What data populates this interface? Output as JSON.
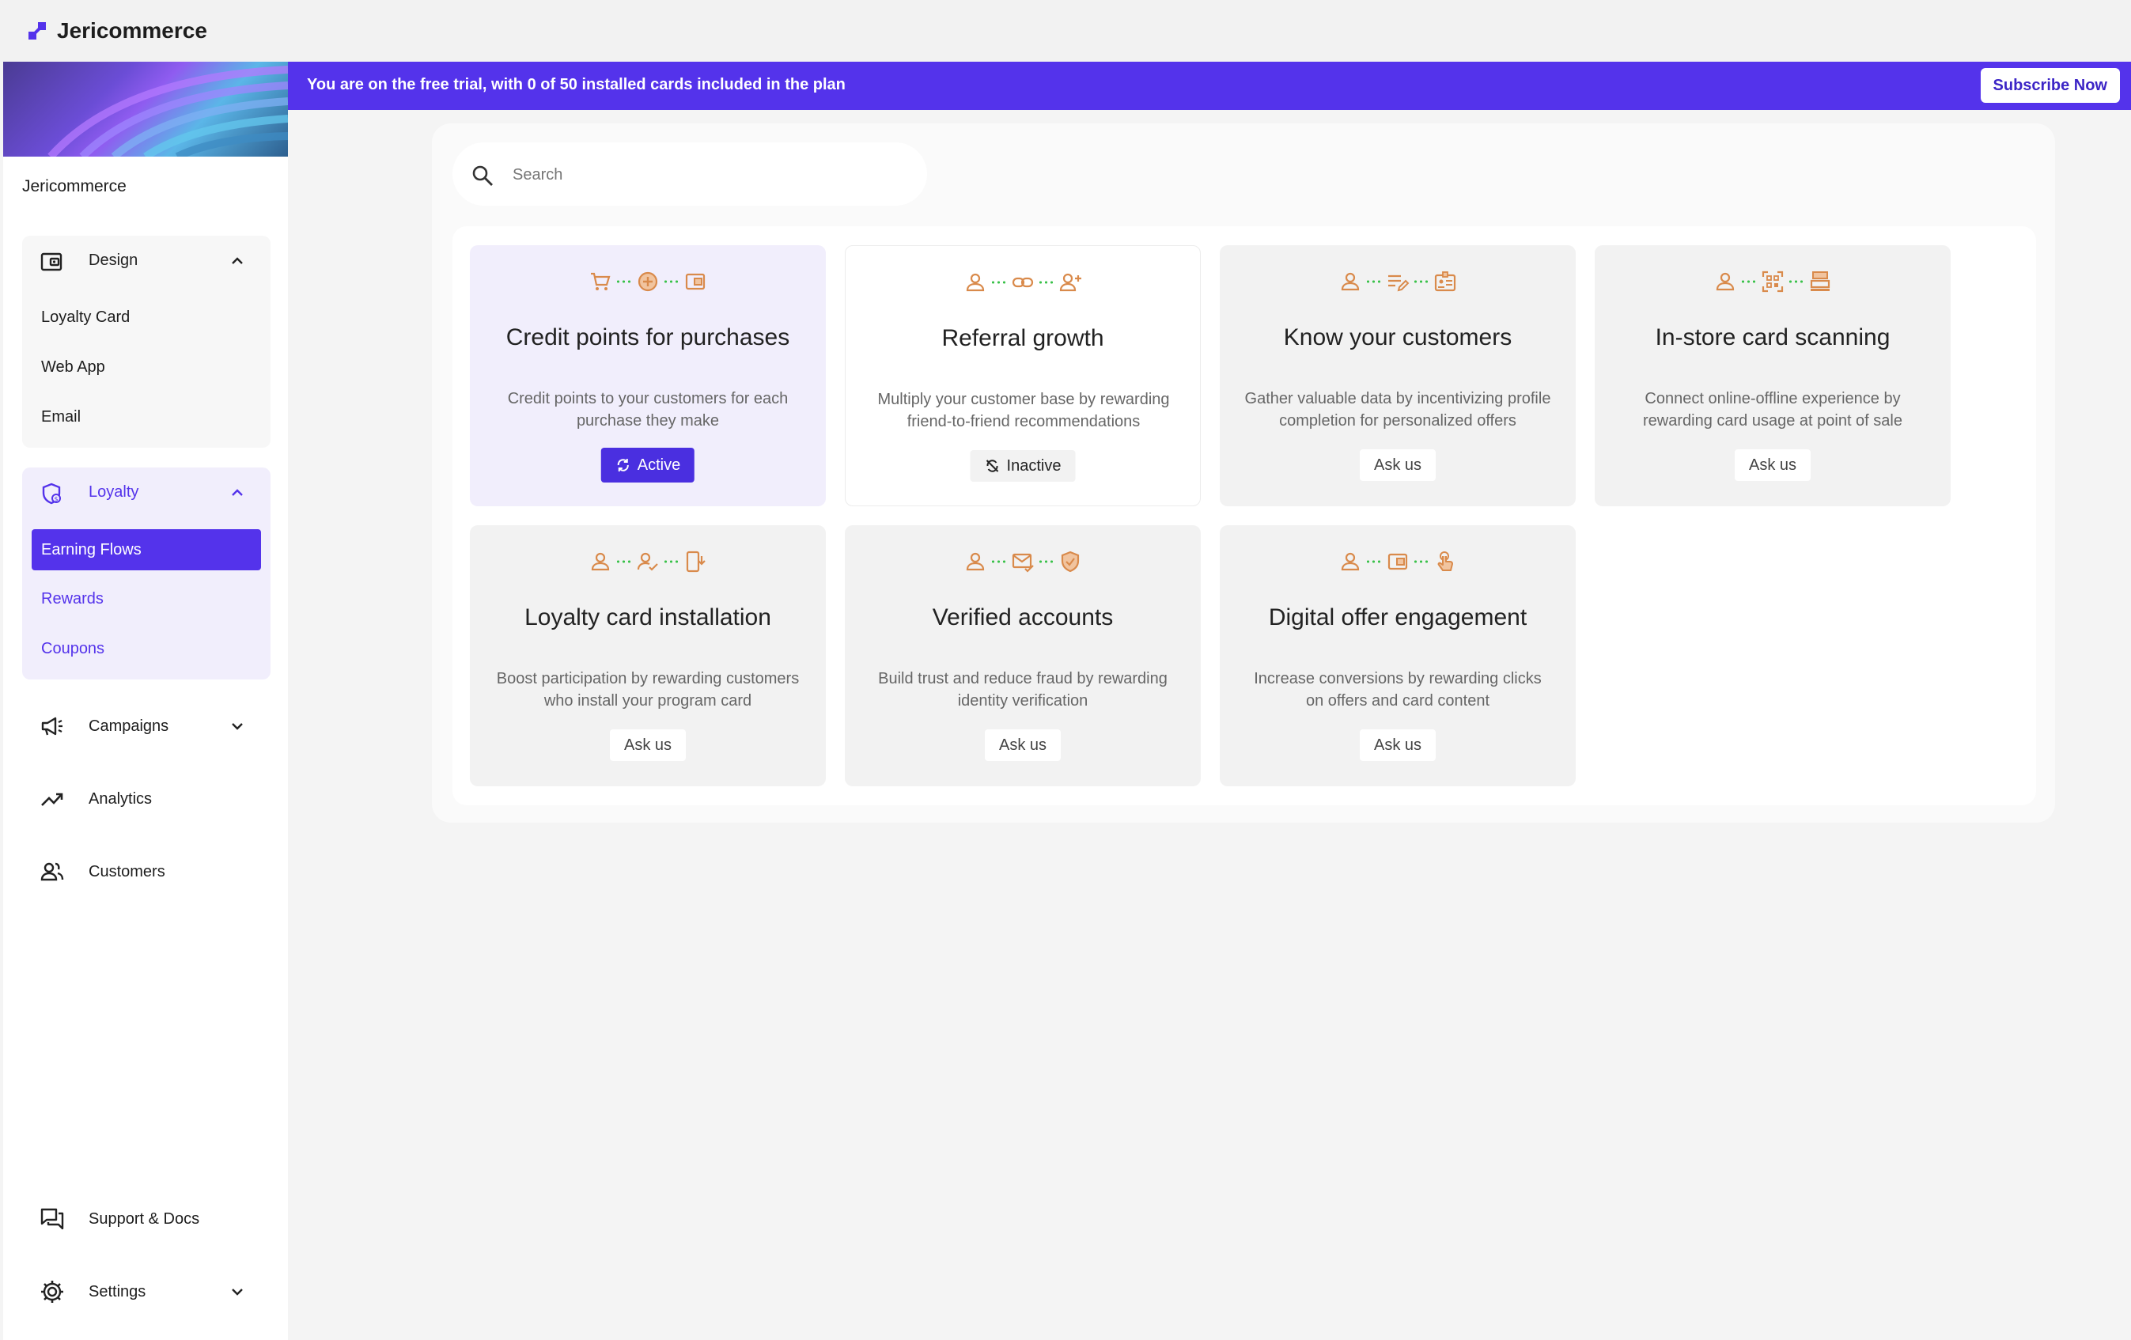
{
  "app": {
    "brand": "Jericommerce"
  },
  "sidebar": {
    "workspace": "Jericommerce",
    "design": {
      "label": "Design",
      "items": [
        "Loyalty Card",
        "Web App",
        "Email"
      ]
    },
    "loyalty": {
      "label": "Loyalty",
      "items": [
        "Earning Flows",
        "Rewards",
        "Coupons"
      ],
      "selected": "Earning Flows"
    },
    "campaigns": "Campaigns",
    "analytics": "Analytics",
    "customers": "Customers",
    "support": "Support & Docs",
    "settings": "Settings"
  },
  "banner": {
    "text": "You are on the free trial, with 0 of 50 installed cards included in the plan",
    "button": "Subscribe Now"
  },
  "search": {
    "placeholder": "Search"
  },
  "cards": [
    {
      "title": "Credit points for purchases",
      "desc": "Credit points to your customers for each purchase they make",
      "status": "Active",
      "icons": [
        "cart-icon",
        "plus-circle-icon",
        "wallet-icon"
      ]
    },
    {
      "title": "Referral growth",
      "desc": "Multiply your customer base by rewarding friend-to-friend recommendations",
      "status": "Inactive",
      "icons": [
        "person-icon",
        "link-icon",
        "person-add-icon"
      ]
    },
    {
      "title": "Know your customers",
      "desc": "Gather valuable data by incentivizing profile completion for personalized offers",
      "status": "Ask us",
      "icons": [
        "person-icon",
        "edit-note-icon",
        "id-card-icon"
      ]
    },
    {
      "title": "In-store card scanning",
      "desc": "Connect online-offline experience by rewarding card usage at point of sale",
      "status": "Ask us",
      "icons": [
        "person-icon",
        "qr-scan-icon",
        "register-icon"
      ]
    },
    {
      "title": "Loyalty card installation",
      "desc": "Boost participation by rewarding customers who install your program card",
      "status": "Ask us",
      "icons": [
        "person-icon",
        "person-check-icon",
        "phone-download-icon"
      ]
    },
    {
      "title": "Verified accounts",
      "desc": "Build trust and reduce fraud by rewarding identity verification",
      "status": "Ask us",
      "icons": [
        "person-icon",
        "mail-check-icon",
        "shield-check-icon"
      ]
    },
    {
      "title": "Digital offer engagement",
      "desc": "Increase conversions by rewarding clicks on offers and card content",
      "status": "Ask us",
      "icons": [
        "person-icon",
        "wallet-icon",
        "touch-icon"
      ]
    }
  ],
  "colors": {
    "accent": "#5433eb",
    "icon": "#d98a4b",
    "connector": "#3bc24b"
  }
}
